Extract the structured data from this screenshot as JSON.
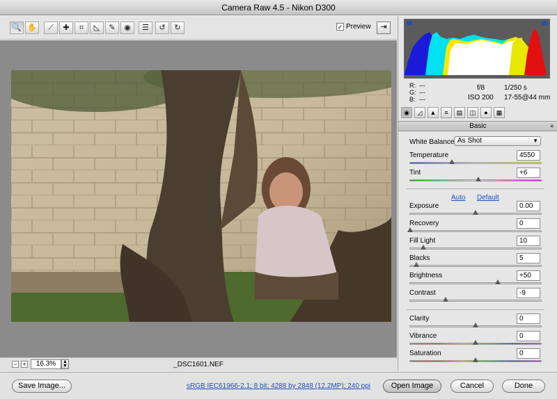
{
  "window": {
    "title": "Camera Raw 4.5  -  Nikon D300"
  },
  "toolbar": {
    "tools": [
      "zoom-icon",
      "hand-icon",
      "eyedropper-icon",
      "color-sampler-icon",
      "crop-icon",
      "straighten-icon",
      "retouch-icon",
      "red-eye-icon",
      "preferences-icon",
      "rotate-left-icon",
      "rotate-right-icon"
    ],
    "preview_label": "Preview",
    "preview_checked": "✓",
    "fullscreen_glyph": "⇥"
  },
  "canvas": {
    "zoom": "16.3%",
    "filename": "_DSC1601.NEF"
  },
  "readout": {
    "r_label": "R:",
    "r_value": "---",
    "g_label": "G:",
    "g_value": "---",
    "b_label": "B:",
    "b_value": "---",
    "aperture": "f/8",
    "shutter": "1/250 s",
    "iso": "ISO 200",
    "lens": "17-55@44 mm"
  },
  "panel": {
    "title": "Basic",
    "menu_glyph": "≡",
    "white_balance_label": "White Balance:",
    "white_balance_value": "As Shot",
    "auto_label": "Auto",
    "default_label": "Default",
    "sliders": [
      {
        "label": "Temperature",
        "value": "4550",
        "pos": 0.32
      },
      {
        "label": "Tint",
        "value": "+6",
        "pos": 0.52
      },
      {
        "label": "Exposure",
        "value": "0.00",
        "pos": 0.5
      },
      {
        "label": "Recovery",
        "value": "0",
        "pos": 0.0
      },
      {
        "label": "Fill Light",
        "value": "10",
        "pos": 0.1
      },
      {
        "label": "Blacks",
        "value": "5",
        "pos": 0.05
      },
      {
        "label": "Brightness",
        "value": "+50",
        "pos": 0.67
      },
      {
        "label": "Contrast",
        "value": "-9",
        "pos": 0.27
      },
      {
        "label": "Clarity",
        "value": "0",
        "pos": 0.5
      },
      {
        "label": "Vibrance",
        "value": "0",
        "pos": 0.5
      },
      {
        "label": "Saturation",
        "value": "0",
        "pos": 0.5
      }
    ]
  },
  "footer": {
    "save_label": "Save Image...",
    "workflow_text": "sRGB IEC61966-2.1; 8 bit; 4288 by 2848 (12.2MP); 240 ppi",
    "open_label": "Open Image",
    "cancel_label": "Cancel",
    "done_label": "Done"
  },
  "colors": {
    "canvas_bg": "#8b8b8b",
    "link": "#1c4fb8"
  }
}
